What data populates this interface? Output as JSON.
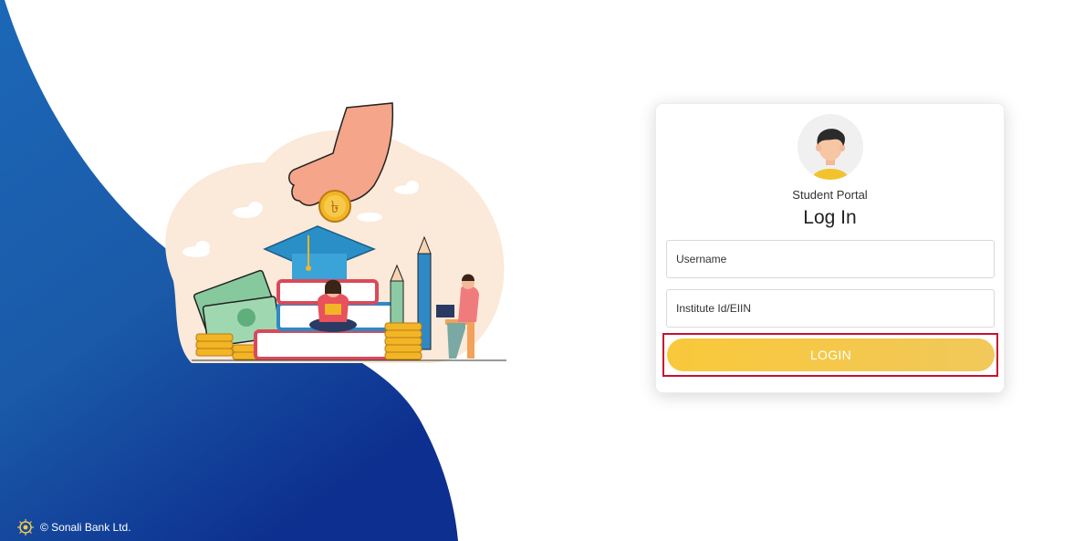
{
  "brand": {
    "copyright_text": "© Sonali Bank Ltd.",
    "wave_color": "#0e4c9e"
  },
  "hero": {
    "coin_symbol": "৳"
  },
  "login_card": {
    "portal_label": "Student Portal",
    "title": "Log In",
    "username": {
      "placeholder": "Username",
      "value": ""
    },
    "institute": {
      "placeholder": "Institute Id/EIIN",
      "value": ""
    },
    "login_button_label": "LOGIN",
    "accent_color": "#f9c83a",
    "highlight_color": "#c8102e"
  }
}
